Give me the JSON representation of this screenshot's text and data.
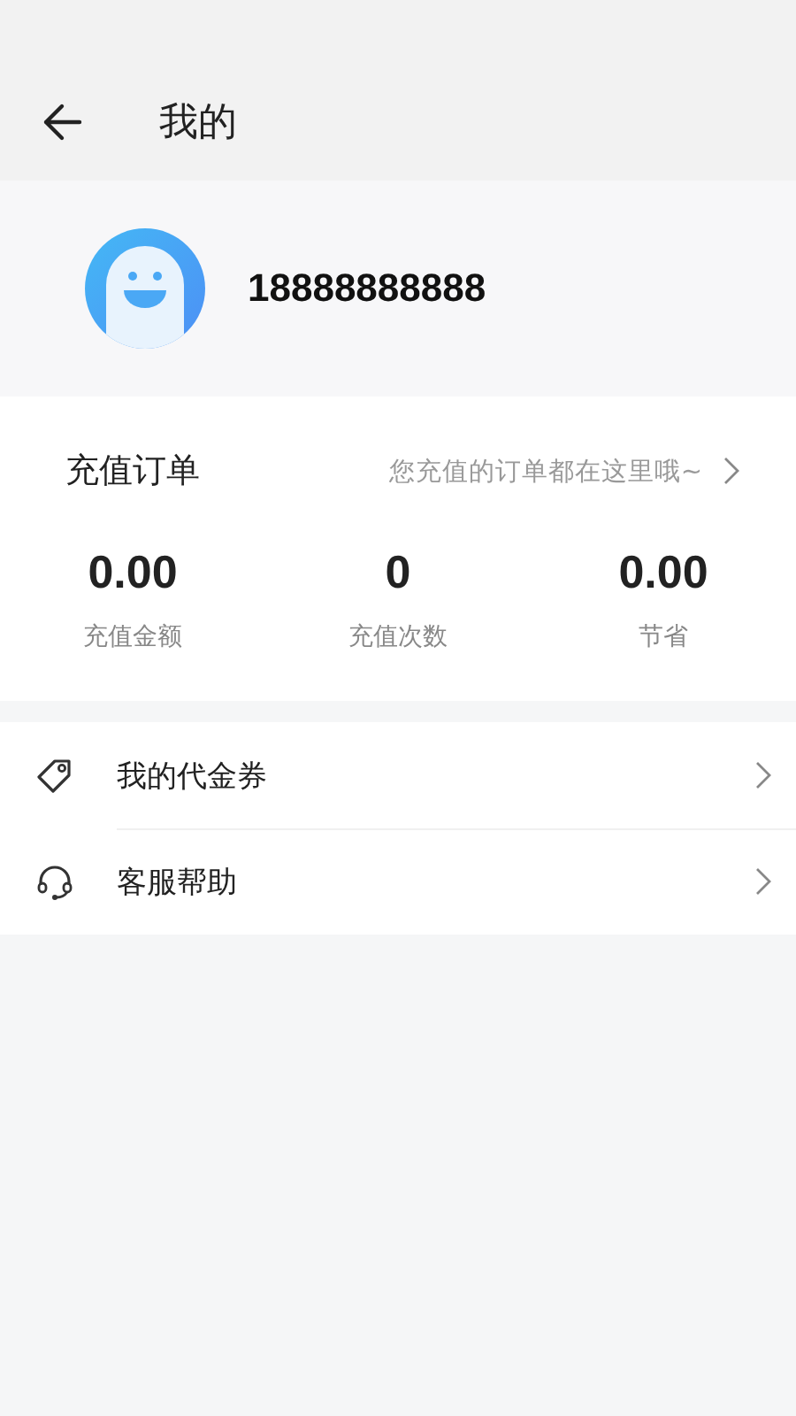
{
  "header": {
    "title": "我的"
  },
  "profile": {
    "phone": "18888888888"
  },
  "orders": {
    "title": "充值订单",
    "hint": "您充值的订单都在这里哦~",
    "stats": [
      {
        "value": "0.00",
        "label": "充值金额"
      },
      {
        "value": "0",
        "label": "充值次数"
      },
      {
        "value": "0.00",
        "label": "节省"
      }
    ]
  },
  "menu": [
    {
      "kind": "coupon",
      "label": "我的代金券"
    },
    {
      "kind": "support",
      "label": "客服帮助"
    }
  ]
}
